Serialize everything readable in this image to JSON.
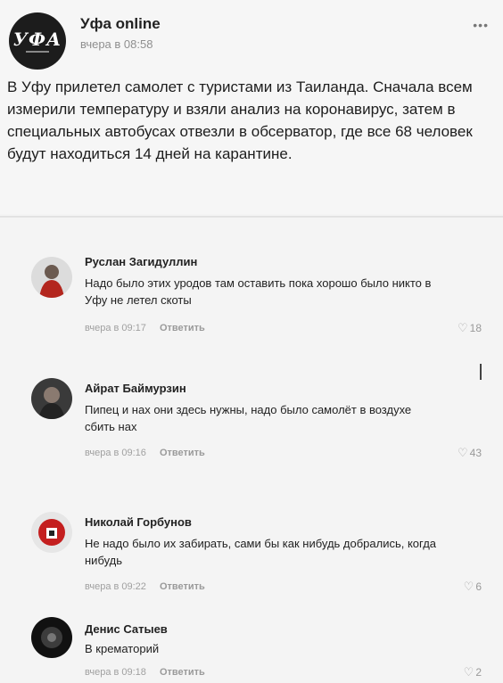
{
  "post": {
    "author": "Уфа online",
    "avatar_text": "УФА",
    "time": "вчера в 08:58",
    "more_icon": "more-dots-icon",
    "text": "В Уфу прилетел самолет с туристами из Таиланда. Сначала всем измерили температуру и взяли анализ на коронавирус, затем в специальных автобусах отвезли в обсерватор, где все 68 человек будут находиться 14 дней на карантине."
  },
  "comments": [
    {
      "name": "Руслан Загидуллин",
      "text": "Надо было этих уродов там оставить пока хорошо было никто в Уфу не летел скоты",
      "time": "вчера в 09:17",
      "reply": "Ответить",
      "likes": "18"
    },
    {
      "name": "Айрат Баймурзин",
      "text": "Пипец и нах они здесь нужны, надо было самолёт в воздухе сбить нах",
      "time": "вчера в 09:16",
      "reply": "Ответить",
      "likes": "43"
    },
    {
      "name": "Николай Горбунов",
      "text": "Не надо было их забирать, сами бы как нибудь добрались, когда нибудь",
      "time": "вчера в 09:22",
      "reply": "Ответить",
      "likes": "6"
    },
    {
      "name": "Денис Сатыев",
      "text": "В крематорий",
      "time": "вчера в 09:18",
      "reply": "Ответить",
      "likes": "2"
    }
  ],
  "icons": {
    "like": "heart-outline-icon"
  },
  "colors": {
    "background": "#f4f4f4",
    "meta": "#a0a0a0"
  }
}
